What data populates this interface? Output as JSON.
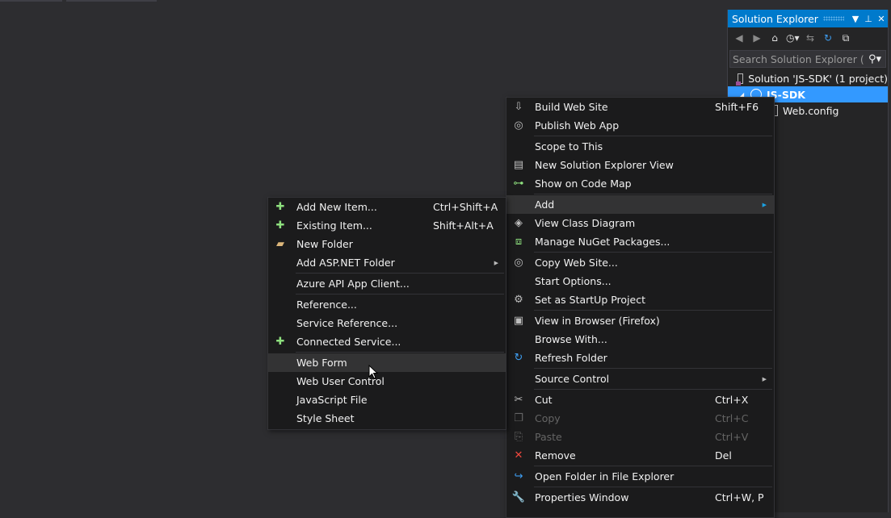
{
  "solution_explorer": {
    "title": "Solution Explorer",
    "title_buttons": [
      "▾",
      "⊺",
      "✕"
    ],
    "search_placeholder": "Search Solution Explorer (C",
    "tree": [
      {
        "label": "Solution 'JS-SDK' (1 project)",
        "icon": "solution-icon"
      },
      {
        "label": "JS-SDK",
        "icon": "website-globe-icon",
        "selected": true
      },
      {
        "label": "Web.config",
        "icon": "config-file-icon"
      }
    ]
  },
  "context_menu": {
    "items": [
      {
        "label": "Build Web Site",
        "shortcut": "Shift+F6",
        "icon": "build-icon",
        "glyph": "⇩"
      },
      {
        "label": "Publish Web App",
        "icon": "publish-globe-icon",
        "glyph": "◎"
      },
      {
        "sep": true
      },
      {
        "label": "Scope to This"
      },
      {
        "label": "New Solution Explorer View",
        "icon": "new-view-icon",
        "glyph": "▤"
      },
      {
        "label": "Show on Code Map",
        "icon": "code-map-icon",
        "glyph": "⊶"
      },
      {
        "sep": true
      },
      {
        "label": "Add",
        "submenu": true,
        "highlighted": true
      },
      {
        "label": "View Class Diagram",
        "icon": "class-diagram-icon",
        "glyph": "◈"
      },
      {
        "label": "Manage NuGet Packages...",
        "icon": "nuget-icon",
        "glyph": "⧈"
      },
      {
        "sep": true
      },
      {
        "label": "Copy Web Site...",
        "icon": "copy-website-icon",
        "glyph": "◎"
      },
      {
        "label": "Start Options..."
      },
      {
        "label": "Set as StartUp Project",
        "icon": "gear-icon",
        "glyph": "⚙"
      },
      {
        "sep": true
      },
      {
        "label": "View in Browser (Firefox)",
        "icon": "browser-icon",
        "glyph": "▣"
      },
      {
        "label": "Browse With..."
      },
      {
        "label": "Refresh Folder",
        "icon": "refresh-icon",
        "glyph": "↻"
      },
      {
        "sep": true
      },
      {
        "label": "Source Control",
        "submenu": true
      },
      {
        "sep": true
      },
      {
        "label": "Cut",
        "shortcut": "Ctrl+X",
        "icon": "scissors-icon",
        "glyph": "✂"
      },
      {
        "label": "Copy",
        "shortcut": "Ctrl+C",
        "icon": "copy-icon",
        "glyph": "❐",
        "disabled": true
      },
      {
        "label": "Paste",
        "shortcut": "Ctrl+V",
        "icon": "paste-icon",
        "glyph": "⎘",
        "disabled": true
      },
      {
        "label": "Remove",
        "shortcut": "Del",
        "icon": "remove-x-icon",
        "glyph": "✕"
      },
      {
        "sep": true
      },
      {
        "label": "Open Folder in File Explorer",
        "icon": "open-folder-icon",
        "glyph": "↪"
      },
      {
        "sep": true
      },
      {
        "label": "Properties Window",
        "shortcut": "Ctrl+W, P",
        "icon": "wrench-icon",
        "glyph": "🔧"
      }
    ]
  },
  "add_submenu": {
    "items": [
      {
        "label": "Add New Item...",
        "shortcut": "Ctrl+Shift+A",
        "icon": "add-new-item-icon",
        "glyph": "✚"
      },
      {
        "label": "Existing Item...",
        "shortcut": "Shift+Alt+A",
        "icon": "add-existing-item-icon",
        "glyph": "✚"
      },
      {
        "label": "New Folder",
        "icon": "new-folder-icon",
        "glyph": "▰"
      },
      {
        "label": "Add ASP.NET Folder",
        "submenu": true
      },
      {
        "sep": true
      },
      {
        "label": "Azure API App Client..."
      },
      {
        "sep": true
      },
      {
        "label": "Reference..."
      },
      {
        "label": "Service Reference..."
      },
      {
        "label": "Connected Service...",
        "icon": "connected-service-icon",
        "glyph": "✚"
      },
      {
        "sep": true
      },
      {
        "label": "Web Form",
        "highlighted": true
      },
      {
        "label": "Web User Control"
      },
      {
        "label": "JavaScript File"
      },
      {
        "label": "Style Sheet"
      }
    ]
  },
  "colors": {
    "accent": "#007acc",
    "selection": "#3399ff",
    "menu_bg": "#1b1b1c",
    "background": "#2d2d30"
  }
}
